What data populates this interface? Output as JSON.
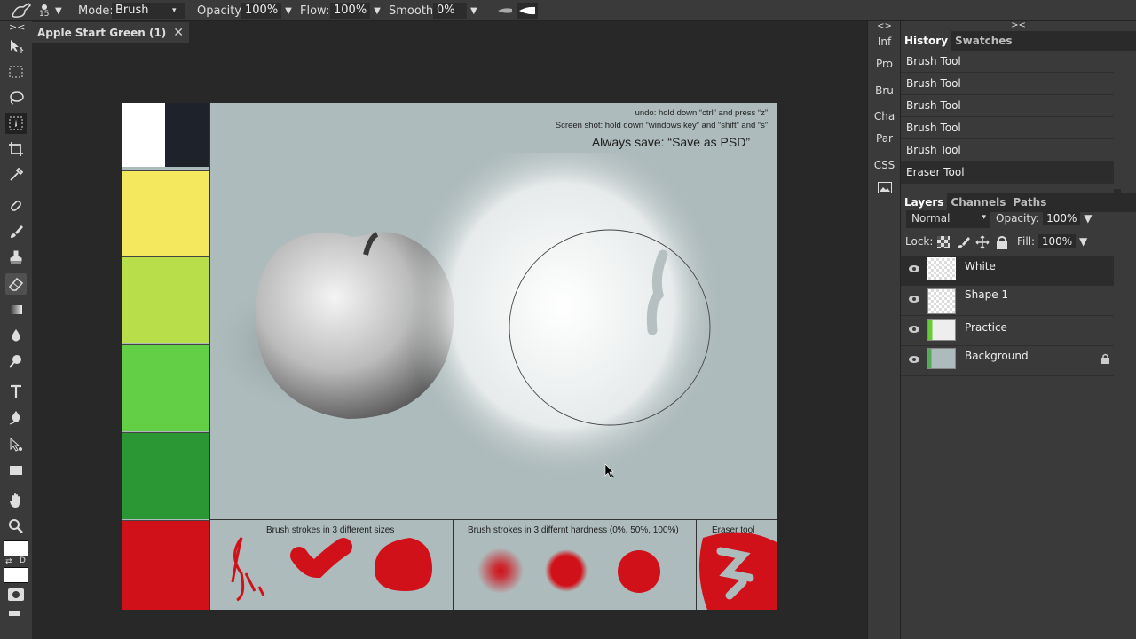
{
  "topbar": {
    "brush_size": "15",
    "mode_label": "Mode:",
    "mode_value": "Brush",
    "opacity_label": "Opacity:",
    "opacity_value": "100%",
    "flow_label": "Flow:",
    "flow_value": "100%",
    "smooth_label": "Smooth:",
    "smooth_value": "0%"
  },
  "toolbar": {
    "collapse": "><",
    "tools": [
      "move-icon",
      "marquee-icon",
      "lasso-icon",
      "quick-select-icon",
      "crop-icon",
      "eyedropper-icon",
      "healing-icon",
      "brush-icon",
      "stamp-icon",
      "eraser-icon",
      "gradient-icon",
      "blur-icon",
      "dodge-icon",
      "type-icon",
      "pen-icon",
      "path-select-icon",
      "rectangle-icon",
      "hand-icon",
      "zoom-icon"
    ],
    "default_colors_label": "D"
  },
  "document": {
    "tab_title": "Apple Start Green (1)",
    "close": "✕"
  },
  "canvas": {
    "undo_hint": "undo:  hold down “ctrl” and press “z”",
    "screenshot_hint": "Screen shot: hold down “windows key” and “shift” and “s”",
    "save_hint": "Always save: “Save as PSD”",
    "brush_sizes_caption": "Brush strokes in 3 different sizes",
    "hardness_caption": "Brush strokes in 3 differnt hardness (0%, 50%, 100%)",
    "eraser_caption": "Eraser tool",
    "swatch_colors": [
      "#ffffff",
      "#1e232b",
      "#f4e85e",
      "#b8df4a",
      "#62cf46",
      "#2a9634",
      "#d0111a"
    ]
  },
  "side_strip": {
    "expand": "<>",
    "items": [
      "Inf",
      "Pro",
      "Bru",
      "Cha",
      "Par",
      "CSS"
    ]
  },
  "panels": {
    "collapse": "><",
    "history_tabs": [
      "History",
      "Swatches"
    ],
    "history_items": [
      "Brush Tool",
      "Brush Tool",
      "Brush Tool",
      "Brush Tool",
      "Brush Tool",
      "Eraser Tool"
    ],
    "layer_tabs": [
      "Layers",
      "Channels",
      "Paths"
    ],
    "blend_mode": "Normal",
    "opacity_label": "Opacity:",
    "opacity_value": "100%",
    "lock_label": "Lock:",
    "fill_label": "Fill:",
    "fill_value": "100%",
    "layers": [
      "White",
      "Shape 1",
      "Practice",
      "Background"
    ]
  }
}
